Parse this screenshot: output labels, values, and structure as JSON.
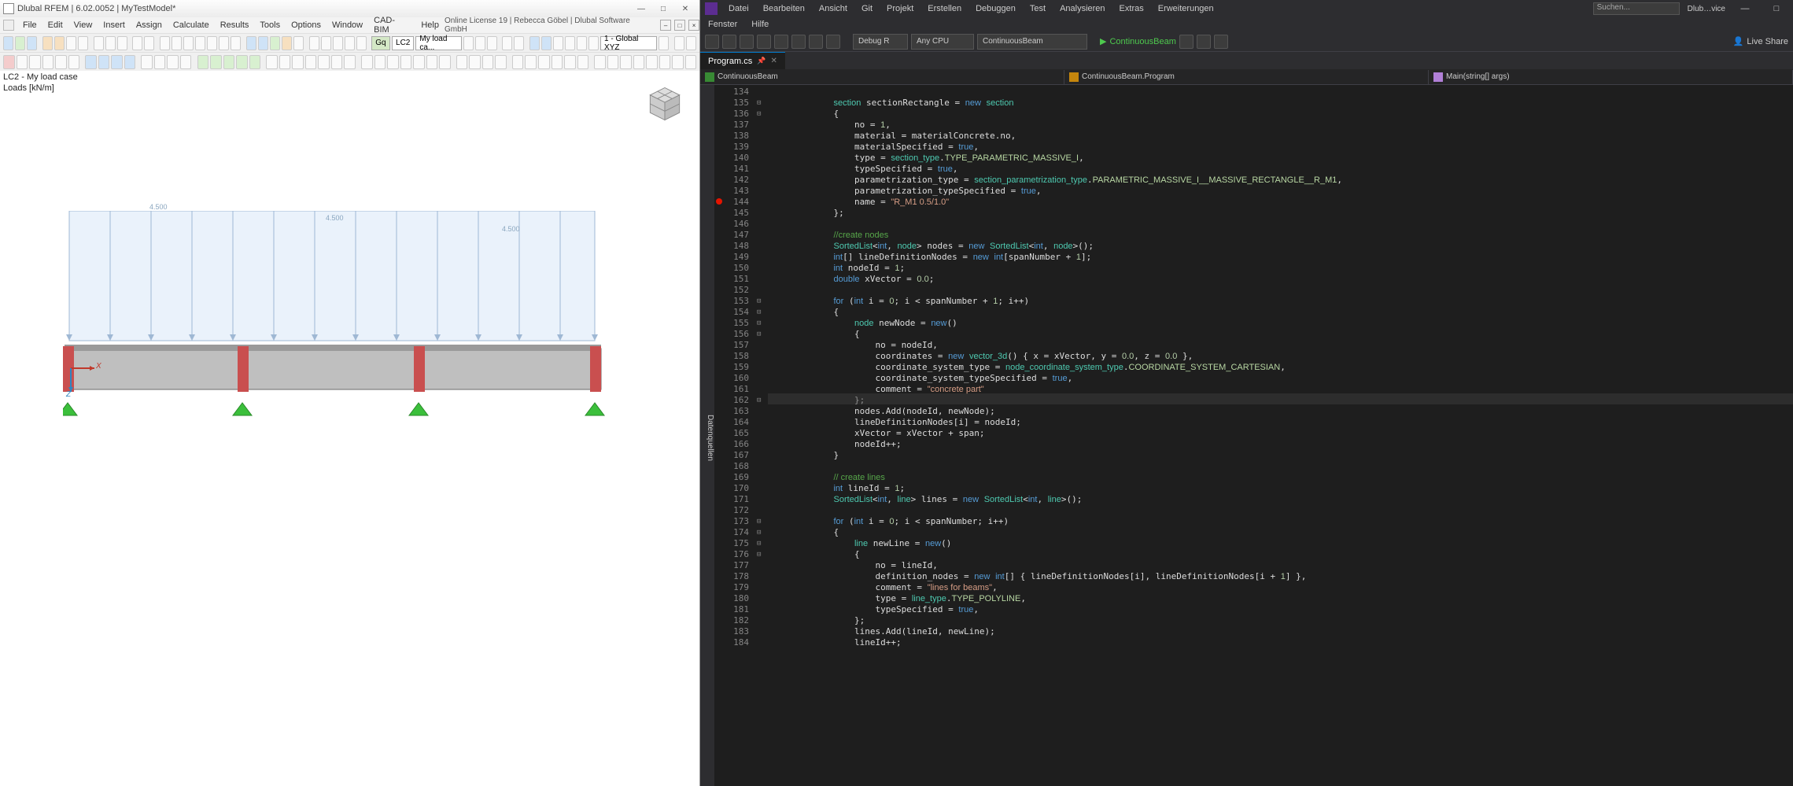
{
  "rfem": {
    "title": "Dlubal RFEM | 6.02.0052 | MyTestModel*",
    "menu": [
      "File",
      "Edit",
      "View",
      "Insert",
      "Assign",
      "Calculate",
      "Results",
      "Tools",
      "Options",
      "Window",
      "CAD-BIM",
      "Help"
    ],
    "license": "Online License 19 | Rebecca Göbel | Dlubal Software GmbH",
    "tb2": {
      "gq": "Gq",
      "lc2": "LC2",
      "lcdrop": "My load ca...",
      "csys": "1 - Global XYZ"
    },
    "view": {
      "hdr": "LC2 - My load case",
      "hdr2": "Loads [kN/m]",
      "dim1": "4.500",
      "dim2": "4.500",
      "dim3": "4.500",
      "axisX": "X",
      "axisZ": "Z"
    }
  },
  "vs": {
    "menu1": [
      "Datei",
      "Bearbeiten",
      "Ansicht",
      "Git",
      "Projekt",
      "Erstellen",
      "Debuggen",
      "Test",
      "Analysieren",
      "Extras",
      "Erweiterungen"
    ],
    "menu2": [
      "Fenster",
      "Hilfe"
    ],
    "search_ph": "Suchen...",
    "account": "Dlub…vice",
    "tb": {
      "cfg": "Debug R",
      "plat": "Any CPU",
      "proj": "ContinuousBeam",
      "run": "ContinuousBeam",
      "share": "Live Share"
    },
    "tab": "Program.cs",
    "nav": {
      "asm": "ContinuousBeam",
      "ns": "ContinuousBeam.Program",
      "mth": "Main(string[] args)"
    },
    "side": "Datenquellen",
    "first_line": 134,
    "last_line": 184,
    "code_lines": [
      "",
      "            <span class='cls'>section</span> sectionRectangle = <span class='kw'>new</span> <span class='cls'>section</span>",
      "            {",
      "                no = <span class='num'>1</span>,",
      "                material = materialConcrete.no,",
      "                materialSpecified = <span class='kw'>true</span>,",
      "                type = <span class='cls'>section_type</span>.<span class='enm'>TYPE_PARAMETRIC_MASSIVE_I</span>,",
      "                typeSpecified = <span class='kw'>true</span>,",
      "                parametrization_type = <span class='cls'>section_parametrization_type</span>.<span class='enm'>PARAMETRIC_MASSIVE_I__MASSIVE_RECTANGLE__R_M1</span>,",
      "                parametrization_typeSpecified = <span class='kw'>true</span>,",
      "                name = <span class='str'>\"R_M1 0.5/1.0\"</span>",
      "            };",
      "",
      "            <span class='cmt'>//create nodes</span>",
      "            <span class='cls'>SortedList</span>&lt;<span class='kw'>int</span>, <span class='cls'>node</span>&gt; nodes = <span class='kw'>new</span> <span class='cls'>SortedList</span>&lt;<span class='kw'>int</span>, <span class='cls'>node</span>&gt;();",
      "            <span class='kw'>int</span>[] lineDefinitionNodes = <span class='kw'>new</span> <span class='kw'>int</span>[spanNumber + <span class='num'>1</span>];",
      "            <span class='kw'>int</span> nodeId = <span class='num'>1</span>;",
      "            <span class='kw'>double</span> xVector = <span class='num'>0.0</span>;",
      "",
      "            <span class='kw'>for</span> (<span class='kw'>int</span> i = <span class='num'>0</span>; i &lt; spanNumber + <span class='num'>1</span>; i++)",
      "            {",
      "                <span class='cls'>node</span> newNode = <span class='kw'>new</span>()",
      "                {",
      "                    no = nodeId,",
      "                    coordinates = <span class='kw'>new</span> <span class='cls'>vector_3d</span>() { x = xVector, y = <span class='num'>0.0</span>, z = <span class='num'>0.0</span> },",
      "                    coordinate_system_type = <span class='cls'>node_coordinate_system_type</span>.<span class='enm'>COORDINATE_SYSTEM_CARTESIAN</span>,",
      "                    coordinate_system_typeSpecified = <span class='kw'>true</span>,",
      "                    comment = <span class='str'>\"concrete part\"</span>",
      "                };",
      "                nodes.Add(nodeId, newNode);",
      "                lineDefinitionNodes[i] = nodeId;",
      "                xVector = xVector + span;",
      "                nodeId++;",
      "            }",
      "",
      "            <span class='cmt'>// create lines</span>",
      "            <span class='kw'>int</span> lineId = <span class='num'>1</span>;",
      "            <span class='cls'>SortedList</span>&lt;<span class='kw'>int</span>, <span class='cls'>line</span>&gt; lines = <span class='kw'>new</span> <span class='cls'>SortedList</span>&lt;<span class='kw'>int</span>, <span class='cls'>line</span>&gt;();",
      "",
      "            <span class='kw'>for</span> (<span class='kw'>int</span> i = <span class='num'>0</span>; i &lt; spanNumber; i++)",
      "            {",
      "                <span class='cls'>line</span> newLine = <span class='kw'>new</span>()",
      "                {",
      "                    no = lineId,",
      "                    definition_nodes = <span class='kw'>new</span> <span class='kw'>int</span>[] { lineDefinitionNodes[i], lineDefinitionNodes[i + <span class='num'>1</span>] },",
      "                    comment = <span class='str'>\"lines for beams\"</span>,",
      "                    type = <span class='cls'>line_type</span>.<span class='enm'>TYPE_POLYLINE</span>,",
      "                    typeSpecified = <span class='kw'>true</span>,",
      "                };",
      "                lines.Add(lineId, newLine);",
      "                lineId++;"
    ]
  }
}
